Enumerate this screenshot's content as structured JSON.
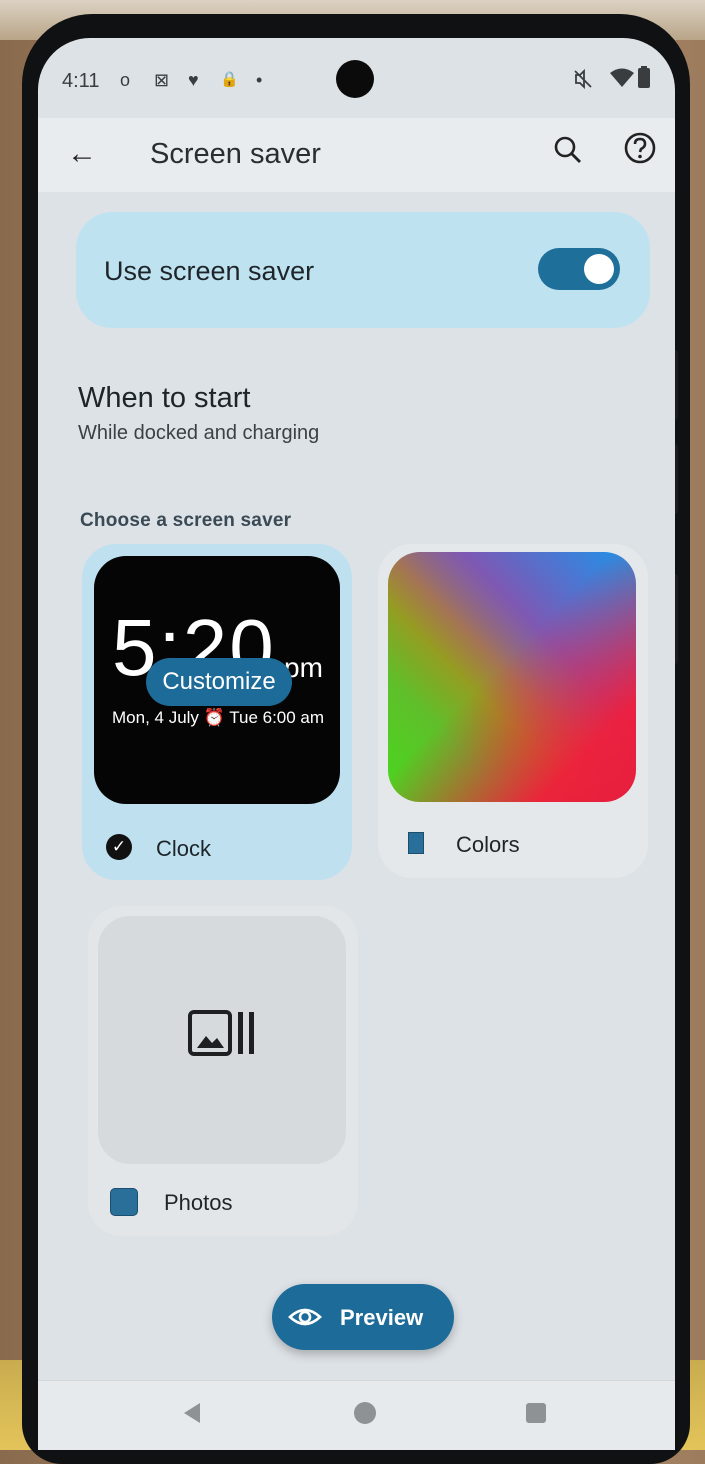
{
  "status_bar": {
    "time": "4:11",
    "notification_icons": [
      "o",
      "⊠",
      "♥",
      "🔒"
    ],
    "dot": "•",
    "right_icons": [
      "mute-icon",
      "wifi-icon",
      "battery-icon"
    ]
  },
  "top_bar": {
    "title": "Screen saver",
    "actions": [
      "search-icon",
      "help-icon"
    ]
  },
  "toggle_card": {
    "label": "Use screen saver",
    "enabled": true
  },
  "when_to_start": {
    "title": "When to start",
    "subtitle": "While docked and charging"
  },
  "section": {
    "label": "Choose a screen saver"
  },
  "options": {
    "clock": {
      "label": "Clock",
      "selected": true,
      "preview_time": "5:20",
      "preview_suffix": "pm",
      "preview_date": "Mon, 4 July ⏰ Tue 6:00 am",
      "customize_label": "Customize"
    },
    "colors": {
      "label": "Colors",
      "selected": false
    },
    "photos": {
      "label": "Photos",
      "selected": false
    }
  },
  "preview_button": {
    "label": "Preview"
  },
  "colors": {
    "accent": "#1d6b98",
    "selected_card": "#bfe0ef",
    "toggle_card": "#bfe2f1"
  }
}
